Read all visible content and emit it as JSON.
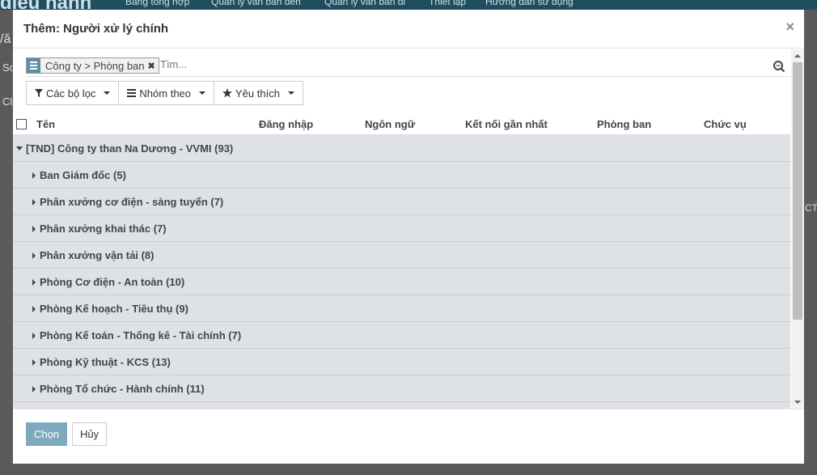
{
  "background": {
    "brand": "điều hành",
    "menu": [
      "Bảng tổng hợp",
      "Quản lý văn bản đến",
      "Quản lý văn bản đi",
      "Thiết lập",
      "Hướng dẫn sử dụng"
    ],
    "fragments": [
      "/ă",
      "Sc",
      "Cl",
      "CT"
    ]
  },
  "dialog": {
    "title": "Thêm: Người xử lý chính",
    "close_icon": "×"
  },
  "search": {
    "facet_value": "Công ty > Phòng ban",
    "facet_remove": "✖",
    "placeholder": "Tìm..."
  },
  "filters": {
    "filters_label": "Các bộ lọc",
    "groupby_label": "Nhóm theo",
    "favorites_label": "Yêu thích"
  },
  "list": {
    "columns": [
      "Tên",
      "Đăng nhập",
      "Ngôn ngữ",
      "Kết nối gần nhất",
      "Phòng ban",
      "Chức vụ"
    ],
    "top_group": "[TND] Công ty than Na Dương - VVMI (93)",
    "subgroups": [
      "Ban Giám đốc (5)",
      "Phân xưởng cơ điện - sàng tuyển (7)",
      "Phân xưởng khai thác (7)",
      "Phân xưởng vận tải (8)",
      "Phòng Cơ điện - An toàn (10)",
      "Phòng Kế hoạch - Tiêu thụ (9)",
      "Phòng Kế toán - Thống kê - Tài chính (7)",
      "Phòng Kỹ thuật - KCS (13)",
      "Phòng Tổ chức - Hành chính (11)"
    ]
  },
  "footer": {
    "select_label": "Chọn",
    "cancel_label": "Hủy"
  },
  "colors": {
    "primary": "#7fa9bf",
    "group_row_bg": "#dee2e6",
    "facet_icon": "#5e8dab"
  }
}
